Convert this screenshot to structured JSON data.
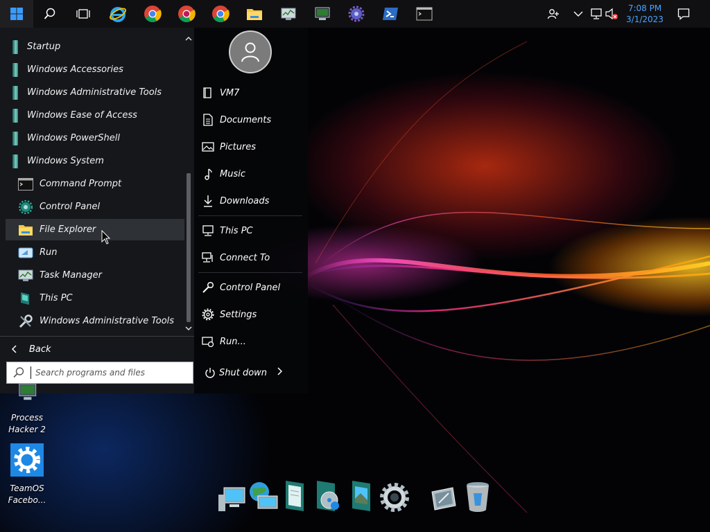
{
  "clock": {
    "time": "7:08 PM",
    "date": "3/1/2023"
  },
  "taskbar": {
    "pinned": [
      {
        "name": "search-icon"
      },
      {
        "name": "task-view-icon"
      },
      {
        "name": "internet-explorer-icon"
      },
      {
        "name": "chrome-icon"
      },
      {
        "name": "chrome-icon"
      },
      {
        "name": "chrome-icon"
      },
      {
        "name": "file-explorer-icon"
      },
      {
        "name": "task-manager-icon"
      },
      {
        "name": "process-hacker-icon"
      },
      {
        "name": "gear-app-icon"
      },
      {
        "name": "powershell-icon"
      },
      {
        "name": "command-prompt-icon"
      }
    ]
  },
  "start_menu": {
    "programs": [
      {
        "label": "Startup",
        "kind": "folder"
      },
      {
        "label": "Windows Accessories",
        "kind": "folder"
      },
      {
        "label": "Windows Administrative Tools",
        "kind": "folder"
      },
      {
        "label": "Windows Ease of Access",
        "kind": "folder"
      },
      {
        "label": "Windows PowerShell",
        "kind": "folder"
      },
      {
        "label": "Windows System",
        "kind": "folder"
      },
      {
        "label": "Command Prompt",
        "kind": "app",
        "icon": "command-prompt-icon"
      },
      {
        "label": "Control Panel",
        "kind": "app",
        "icon": "control-panel-icon"
      },
      {
        "label": "File Explorer",
        "kind": "app",
        "icon": "file-explorer-icon",
        "highlighted": true
      },
      {
        "label": "Run",
        "kind": "app",
        "icon": "run-icon"
      },
      {
        "label": "Task Manager",
        "kind": "app",
        "icon": "task-manager-icon"
      },
      {
        "label": "This PC",
        "kind": "app",
        "icon": "this-pc-icon"
      },
      {
        "label": "Windows Administrative Tools",
        "kind": "app",
        "icon": "admin-tools-icon"
      }
    ],
    "back_label": "Back",
    "search_placeholder": "Search programs and files",
    "places": [
      {
        "label": "VM7",
        "icon": "user-folder-icon"
      },
      {
        "label": "Documents",
        "icon": "document-icon"
      },
      {
        "label": "Pictures",
        "icon": "picture-icon"
      },
      {
        "label": "Music",
        "icon": "music-note-icon"
      },
      {
        "label": "Downloads",
        "icon": "download-icon"
      },
      {
        "label": "This PC",
        "icon": "monitor-icon"
      },
      {
        "label": "Connect To",
        "icon": "connect-icon"
      },
      {
        "label": "Control Panel",
        "icon": "wrench-icon"
      },
      {
        "label": "Settings",
        "icon": "gear-icon"
      },
      {
        "label": "Run...",
        "icon": "run-icon"
      }
    ],
    "shutdown_label": "Shut down"
  },
  "desktop_icons": [
    {
      "label_line1": "Process",
      "label_line2": "Hacker 2"
    },
    {
      "label_line1": "TeamOS",
      "label_line2": "Facebo..."
    }
  ],
  "colors": {
    "accent": "#4aa3ff",
    "taskbar": "#101012",
    "menu_left": "#16181c",
    "highlight": "#2e3136"
  }
}
